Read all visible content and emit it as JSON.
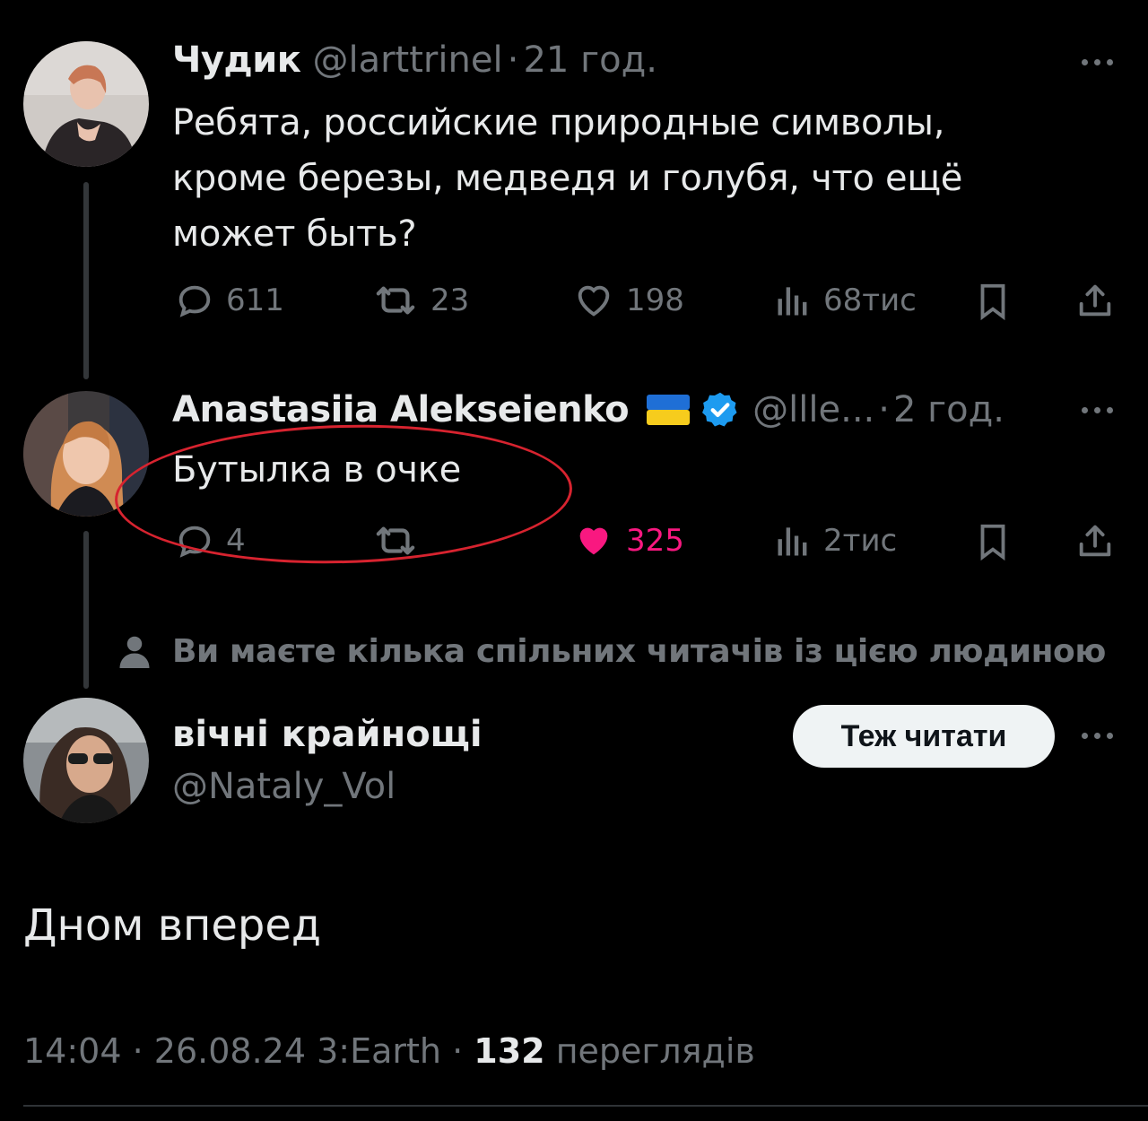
{
  "tweet1": {
    "display_name": "Чудик",
    "handle": "@larttrinel",
    "separator": "·",
    "time": "21 год.",
    "text_line1": "Ребята, российские природные символы,",
    "text_line2": "кроме березы, медведя и голубя, что ещё",
    "text_line3": "может быть?",
    "replies": "611",
    "reposts": "23",
    "likes": "198",
    "views": "68тис"
  },
  "tweet2": {
    "display_name": "Anastasiia Alekseienko",
    "flag": "ukraine-flag",
    "verified": "verified-badge-icon",
    "handle": "@llle...",
    "separator": "·",
    "time": "2 год.",
    "text": "Бутылка в очке",
    "replies": "4",
    "reposts": "",
    "likes": "325",
    "views": "2тис",
    "liked": true
  },
  "social_context": "Ви маєте кілька спільних читачів із цією людиною",
  "main_tweet": {
    "display_name": "вічні крайнощі",
    "handle": "@Nataly_Vol",
    "follow_label": "Теж читати",
    "text": "Дном вперед",
    "time": "14:04",
    "date": "26.08.24",
    "source": "3:Earth",
    "views_count": "132",
    "views_label": "переглядів",
    "separator": "·"
  },
  "colors": {
    "background": "#000000",
    "text": "#e7e9ea",
    "muted": "#71767b",
    "like_active": "#f91880",
    "verified": "#1d9bf0",
    "annotation": "#d7232f"
  }
}
